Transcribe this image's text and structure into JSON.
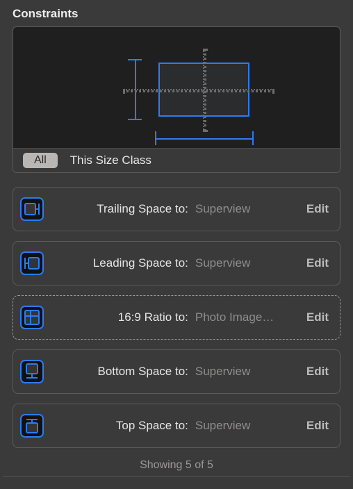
{
  "section": {
    "title": "Constraints"
  },
  "filter": {
    "all_label": "All",
    "size_class_label": "This Size Class"
  },
  "constraints": [
    {
      "icon": "trailing",
      "label": "Trailing Space to:",
      "target": "Superview",
      "edit": "Edit",
      "selected": false
    },
    {
      "icon": "leading",
      "label": "Leading Space to:",
      "target": "Superview",
      "edit": "Edit",
      "selected": false
    },
    {
      "icon": "ratio",
      "label": "16:9 Ratio to:",
      "target": "Photo Image…",
      "edit": "Edit",
      "selected": true
    },
    {
      "icon": "bottom",
      "label": "Bottom Space to:",
      "target": "Superview",
      "edit": "Edit",
      "selected": false
    },
    {
      "icon": "top",
      "label": "Top Space to:",
      "target": "Superview",
      "edit": "Edit",
      "selected": false
    }
  ],
  "footer": {
    "status": "Showing 5 of 5"
  },
  "colors": {
    "accent": "#2d7bf2",
    "bg": "#3b3a3a"
  }
}
